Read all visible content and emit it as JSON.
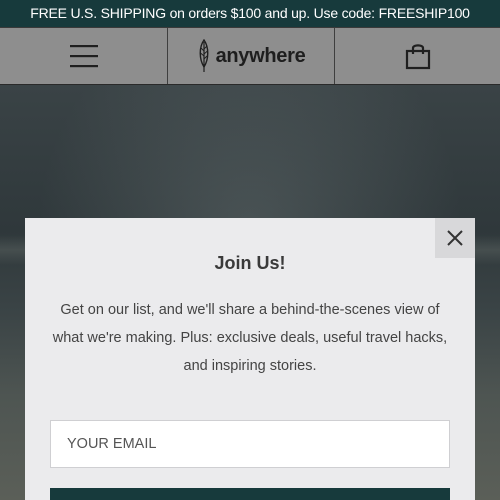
{
  "promo": {
    "text": "FREE U.S. SHIPPING on orders $100 and up. Use code: FREESHIP100"
  },
  "header": {
    "menu_icon": "hamburger-menu-icon",
    "logo_icon": "feather-leaf-icon",
    "logo_text": "anywhere",
    "cart_icon": "shopping-bag-icon"
  },
  "modal": {
    "close_icon": "close-icon",
    "title": "Join Us!",
    "body": "Get on our list, and we'll share a behind-the-scenes view of what we're making. Plus: exclusive deals, useful travel hacks, and inspiring stories.",
    "email_placeholder": "YOUR EMAIL",
    "email_value": ""
  },
  "colors": {
    "brand_dark_teal": "#173a3c",
    "modal_bg": "#ebebed",
    "header_bg": "#8e8e8e"
  }
}
